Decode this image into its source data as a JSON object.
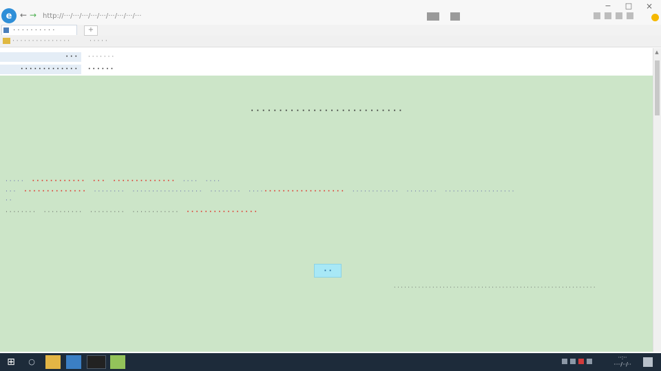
{
  "browser": {
    "logo_text": "e",
    "back_label": "←",
    "forward_label": "→",
    "address": "http://···/···/···/···/···/···/···/···/···",
    "window_min": "−",
    "window_max": "□",
    "window_close": "×"
  },
  "tabs": [
    {
      "label": "· · · · · · · · · ·"
    },
    {
      "label": "+"
    }
  ],
  "bookmarks": [
    {
      "label": "· · · · · · · · · · · · · · ·"
    },
    {
      "label": "· · · · ·"
    }
  ],
  "header_rows": [
    {
      "label": "· · ·",
      "value": "· · · · · · ·"
    },
    {
      "label": "· · · · · · · · · · · · ·",
      "value": "· · · · · ·"
    }
  ],
  "dialog": {
    "title": "· · · · · · · · · · · · · · · · · · · · · · · · · · ·",
    "line1": [
      {
        "text": "· · · · ·",
        "style": "blue"
      },
      {
        "text": "· · · · · · · · · · · ·",
        "style": "red"
      },
      {
        "text": "· · ·",
        "style": "red"
      },
      {
        "text": "· · · · · · · · · · · · · ·",
        "style": "red"
      },
      {
        "text": "· · · ·",
        "style": "blue"
      },
      {
        "text": "· · · ·",
        "style": "blue"
      }
    ],
    "line2": [
      {
        "text": "· · ·",
        "style": "blue"
      },
      {
        "text": "· · · · · · · · · · · · · ·",
        "style": "red"
      },
      {
        "text": "· · · · · · · ·",
        "style": "blue"
      },
      {
        "text": "· · · · · · · · · · · · · · · · · ·",
        "style": "blue"
      },
      {
        "text": "· · · · · · · ·",
        "style": "blue"
      },
      {
        "text": "· · · ·",
        "style": "blue"
      },
      {
        "text": "· · · · · · · · · · · · · · · · · ·",
        "style": "red"
      },
      {
        "text": "· · · · · · · · · · · ·",
        "style": "blue"
      },
      {
        "text": "· · · · · · · ·",
        "style": "blue"
      },
      {
        "text": "· · · · · · · · · · · · · · · · · ·",
        "style": "blue"
      }
    ],
    "line2b": "· ·",
    "line3": [
      {
        "text": "· · · · · · · ·",
        "style": "dark"
      },
      {
        "text": "· · · · · · · · · ·",
        "style": "dark"
      },
      {
        "text": "· · · · · · · · ·",
        "style": "dark"
      },
      {
        "text": "· · · · · · · · · · · ·",
        "style": "dark"
      },
      {
        "text": "· · · · · · · · · · · · · · · ·",
        "style": "red"
      }
    ],
    "confirm_label": "· ·",
    "note": "· · · · · · · · · · · · · · · · · · · · · · · · · · · · · · · · · · · · · · · · · · · · · · · · · · · · · · · · · ·"
  },
  "taskbar": {
    "start_glyph": "⊞",
    "search_glyph": "○",
    "clock_time": "··:··",
    "clock_date": "····/··/··"
  },
  "colors": {
    "dialog_bg": "#cce5c8",
    "accent_red": "#e0342c",
    "accent_blue": "#5b5fa8",
    "button_bg": "#a8e8f6",
    "taskbar_bg": "#1d2b3a"
  }
}
